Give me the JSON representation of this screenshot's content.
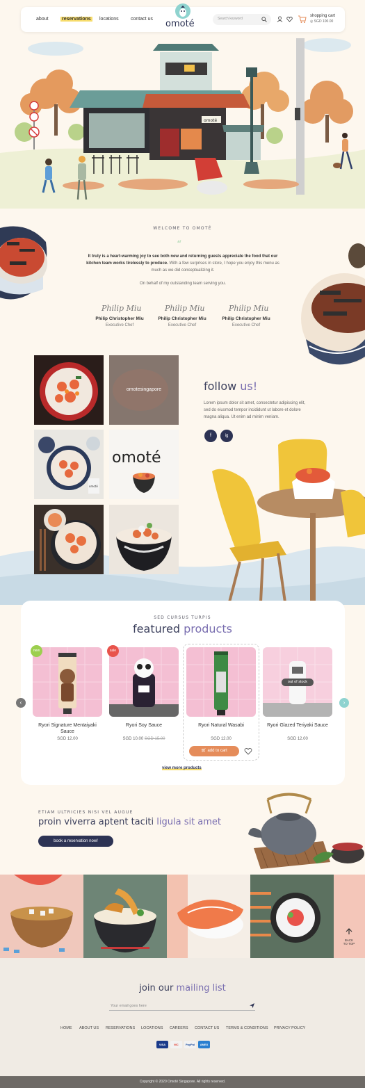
{
  "header": {
    "nav": [
      "about",
      "reservations",
      "locations",
      "contact us"
    ],
    "logo": "omoté",
    "search_placeholder": "Search keyword",
    "cart_label": "shopping cart",
    "cart_total": "SGD 100.00"
  },
  "welcome": {
    "label": "WELCOME TO OMOTÉ",
    "bold": "It truly is a heart-warming joy to see both new and returning guests appreciate the food that our kitchen team works tirelessly to produce.",
    "rest": " With a few surprises in store, I hope you enjoy this menu as much as we did conceptualizing it.",
    "closing": "On behalf of my outstanding team serving you.",
    "chefs": [
      {
        "sign": "Philip Miu",
        "name": "Philip Christopher Miu",
        "title": "Executive Chef"
      },
      {
        "sign": "Philip Miu",
        "name": "Philip Christopher Miu",
        "title": "Executive Chef"
      },
      {
        "sign": "Philip Miu",
        "name": "Philip Christopher Miu",
        "title": "Executive Chef"
      }
    ]
  },
  "follow": {
    "title_a": "follow ",
    "title_b": "us!",
    "text": "Lorem ipsum dolor sit amet, consectetur adipiscing elit, sed do eiusmod tempor incididunt ut labore et dolore magna aliqua. Ut enim ad minim veniam.",
    "instagram_handle": "omotesingapore",
    "logo_word": "omoté",
    "social": [
      "f",
      "ig"
    ]
  },
  "products": {
    "label": "SED CURSUS TURPIS",
    "title_a": "featured ",
    "title_b": "products",
    "items": [
      {
        "name": "Ryori Signature Mentaiyaki Sauce",
        "price": "SGD 12.00",
        "badge": "new",
        "badge_color": "#9ccf4e"
      },
      {
        "name": "Ryori Soy Sauce",
        "price": "SGD 10.00",
        "old_price": "SGD 15.00",
        "badge": "sale",
        "badge_color": "#e8534b"
      },
      {
        "name": "Ryori Natural Wasabi",
        "price": "SGD 12.00",
        "cta": "add to cart"
      },
      {
        "name": "Ryori Glazed Teriyaki Sauce",
        "price": "SGD 12.00",
        "stock": "out of stock"
      }
    ],
    "view_more": "view more products"
  },
  "reservation": {
    "label": "ETIAM ULTRICIES NISI VEL AUGUE",
    "title_a": "proin viverra aptent taciti ",
    "title_b": "ligula sit amet",
    "button": "book a reservation now!"
  },
  "back_to_top": [
    "BACK",
    "TO TOP"
  ],
  "mailing": {
    "title_a": "join our ",
    "title_b": "mailing list",
    "placeholder": "Your email goes here"
  },
  "footer": {
    "links": [
      "HOME",
      "ABOUT US",
      "RESERVATIONS",
      "LOCATIONS",
      "CAREERS",
      "CONTACT US",
      "TERMS & CONDITIONS",
      "PRIVACY POLICY"
    ],
    "payments": [
      "VISA",
      "MC",
      "PayPal",
      "AMEX"
    ],
    "copyright": "Copyright © 2020 Omoté Singapore. All rights reserved."
  },
  "colors": {
    "navy": "#2d3354",
    "purple": "#7a6fb0",
    "orange": "#e58c5a",
    "teal": "#8fd3cf",
    "yellow": "#f7dc6b"
  }
}
